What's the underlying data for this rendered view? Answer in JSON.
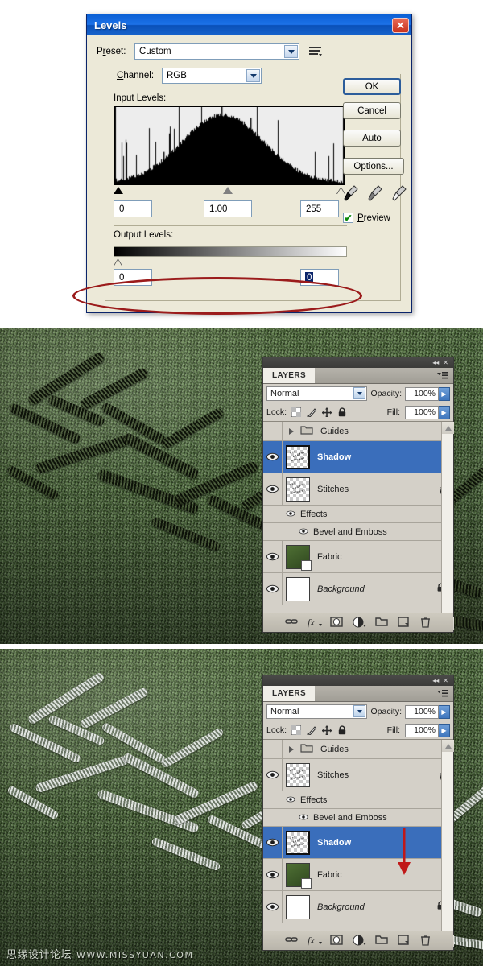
{
  "levels_dialog": {
    "title": "Levels",
    "close_icon": "close-icon",
    "preset": {
      "label": "Preset:",
      "value": "Custom",
      "menu_icon": "preset-options-icon"
    },
    "channel": {
      "label": "Channel:",
      "value": "RGB"
    },
    "input_levels": {
      "label": "Input Levels:",
      "black": "0",
      "gamma": "1.00",
      "white": "255"
    },
    "output_levels": {
      "label": "Output Levels:",
      "black": "0",
      "white": "0"
    },
    "buttons": {
      "ok": "OK",
      "cancel": "Cancel",
      "auto": "Auto",
      "options": "Options..."
    },
    "eyedroppers": [
      "black-point-eyedropper-icon",
      "gray-point-eyedropper-icon",
      "white-point-eyedropper-icon"
    ],
    "preview": {
      "label": "Preview",
      "checked": true,
      "check_glyph": "✔"
    },
    "annotation": {
      "type": "ellipse",
      "color": "#9b1b1b",
      "targets": "output-levels-section"
    }
  },
  "layers_panel_1": {
    "titlebar": {
      "collapse_icon": "◂◂",
      "close_icon": "✕"
    },
    "tab_label": "LAYERS",
    "menu_icon": "panel-menu-icon",
    "blend_mode": "Normal",
    "opacity_label": "Opacity:",
    "opacity_value": "100%",
    "fill_label": "Fill:",
    "fill_value": "100%",
    "lock_label": "Lock:",
    "lock_icons": [
      "lock-transparency-icon",
      "lock-image-icon",
      "lock-position-icon",
      "lock-all-icon"
    ],
    "rows": [
      {
        "kind": "group",
        "name": "Guides",
        "visible": false,
        "selected": false
      },
      {
        "kind": "layer",
        "name": "Shadow",
        "visible": true,
        "selected": true,
        "thumb": "checker",
        "fx": false,
        "locked": false
      },
      {
        "kind": "layer",
        "name": "Stitches",
        "visible": true,
        "selected": false,
        "thumb": "checker",
        "fx": true,
        "locked": false
      },
      {
        "kind": "effect",
        "name": "Effects",
        "visible": true,
        "sub": false
      },
      {
        "kind": "effect",
        "name": "Bevel and Emboss",
        "visible": true,
        "sub": true
      },
      {
        "kind": "layer",
        "name": "Fabric",
        "visible": true,
        "selected": false,
        "thumb": "fabric",
        "fx": false,
        "locked": false,
        "smart_object": true
      },
      {
        "kind": "layer",
        "name": "Background",
        "visible": true,
        "selected": false,
        "thumb": "white",
        "fx": false,
        "locked": true,
        "italic": true
      }
    ],
    "footer_icons": [
      "link-layers-icon",
      "add-layer-style-icon",
      "add-layer-mask-icon",
      "new-adjustment-layer-icon",
      "new-group-icon",
      "new-layer-icon",
      "delete-layer-icon"
    ]
  },
  "layers_panel_2": {
    "titlebar": {
      "collapse_icon": "◂◂",
      "close_icon": "✕"
    },
    "tab_label": "LAYERS",
    "menu_icon": "panel-menu-icon",
    "blend_mode": "Normal",
    "opacity_label": "Opacity:",
    "opacity_value": "100%",
    "fill_label": "Fill:",
    "fill_value": "100%",
    "lock_label": "Lock:",
    "lock_icons": [
      "lock-transparency-icon",
      "lock-image-icon",
      "lock-position-icon",
      "lock-all-icon"
    ],
    "rows": [
      {
        "kind": "group",
        "name": "Guides",
        "visible": false,
        "selected": false
      },
      {
        "kind": "layer",
        "name": "Stitches",
        "visible": true,
        "selected": false,
        "thumb": "checker",
        "fx": true,
        "locked": false
      },
      {
        "kind": "effect",
        "name": "Effects",
        "visible": true,
        "sub": false
      },
      {
        "kind": "effect",
        "name": "Bevel and Emboss",
        "visible": true,
        "sub": true
      },
      {
        "kind": "layer",
        "name": "Shadow",
        "visible": true,
        "selected": true,
        "thumb": "checker",
        "fx": false,
        "locked": false
      },
      {
        "kind": "layer",
        "name": "Fabric",
        "visible": true,
        "selected": false,
        "thumb": "fabric",
        "fx": false,
        "locked": false,
        "smart_object": true
      },
      {
        "kind": "layer",
        "name": "Background",
        "visible": true,
        "selected": false,
        "thumb": "white",
        "fx": false,
        "locked": true,
        "italic": true
      }
    ],
    "footer_icons": [
      "link-layers-icon",
      "add-layer-style-icon",
      "add-layer-mask-icon",
      "new-adjustment-layer-icon",
      "new-group-icon",
      "new-layer-icon",
      "delete-layer-icon"
    ],
    "annotation": {
      "type": "arrow",
      "color": "#c01818",
      "direction": "down",
      "targets": "shadow-layer-row"
    }
  },
  "photos": {
    "upper": {
      "description": "green woven fabric with dark stitched script lettering",
      "stitch_color": "#161c0e",
      "fabric_color": "#4c6e36"
    },
    "lower": {
      "description": "green woven fabric with light gray stitched script lettering",
      "stitch_color": "#dcdfdc",
      "fabric_color": "#4c6e36"
    }
  },
  "watermark": {
    "text": "思缘设计论坛",
    "url": "WWW.MISSYUAN.COM"
  }
}
